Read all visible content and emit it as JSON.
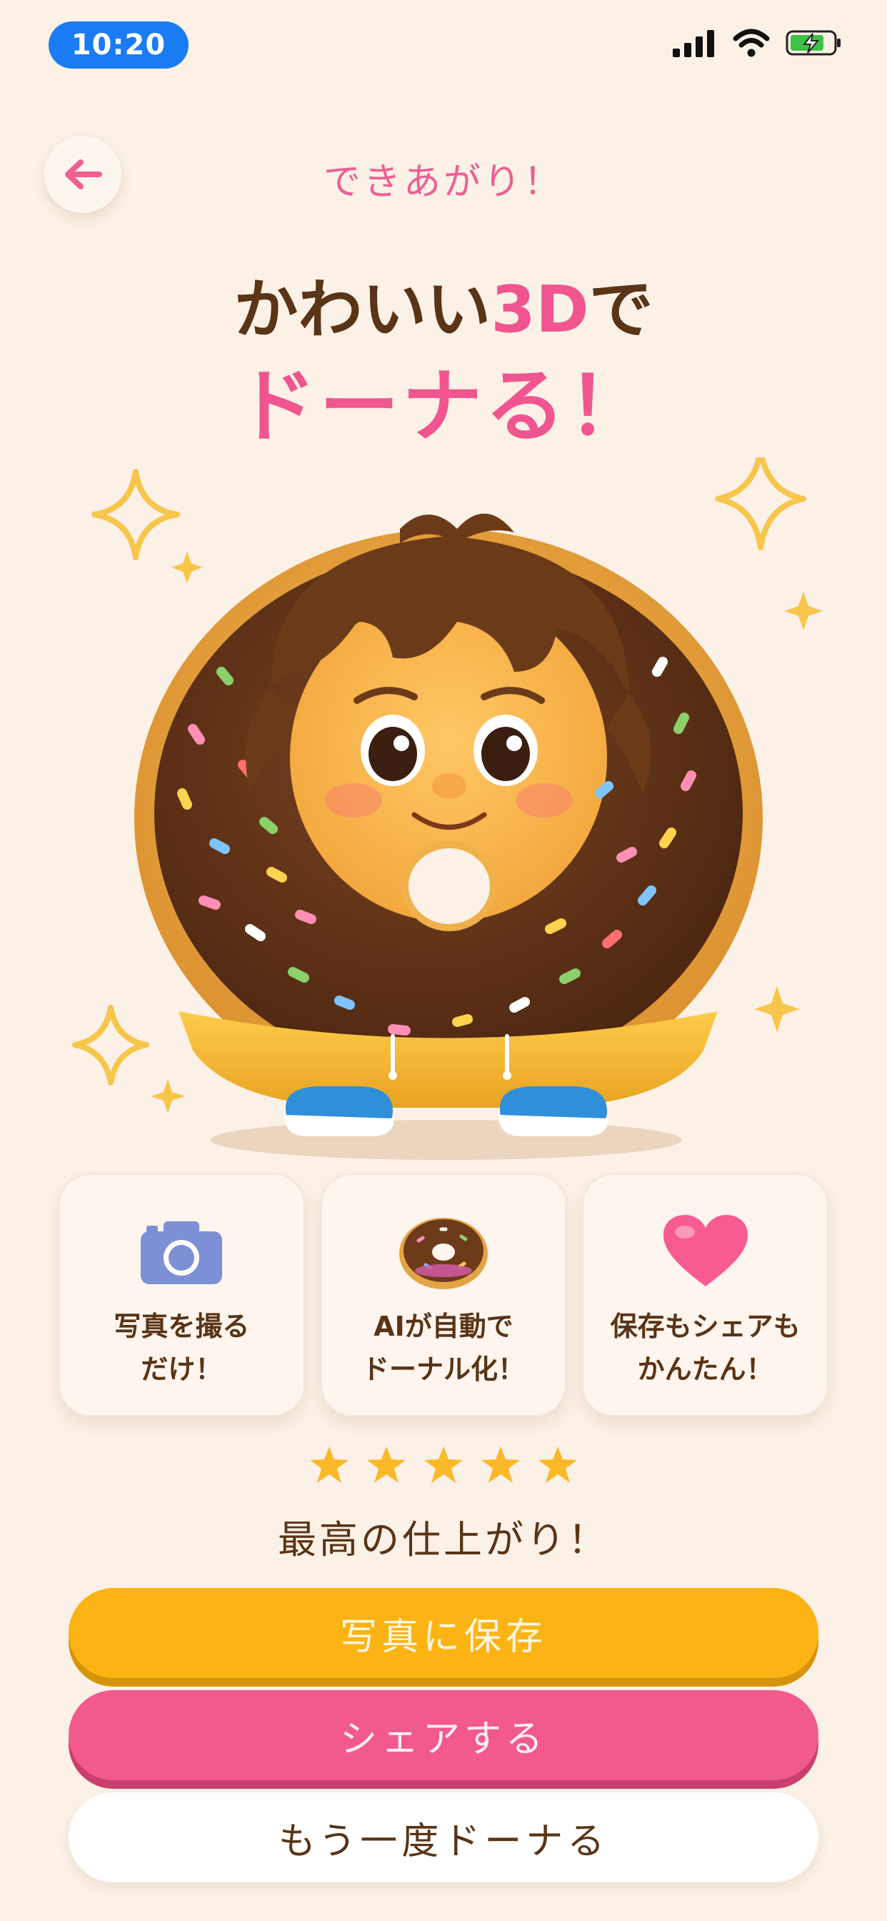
{
  "status_bar": {
    "time": "10:20"
  },
  "header": {
    "title": "できあがり！"
  },
  "headline": {
    "line1_prefix": "かわいい",
    "line1_highlight": "3D",
    "line1_suffix": "で",
    "line2": "ドーナる！"
  },
  "features": [
    {
      "icon": "camera-icon",
      "line1": "写真を撮る",
      "line2": "だけ！"
    },
    {
      "icon": "donut-icon",
      "line1": "AIが自動で",
      "line2": "ドーナル化！"
    },
    {
      "icon": "heart-icon",
      "line1": "保存もシェアも",
      "line2": "かんたん！"
    }
  ],
  "rating": {
    "stars": 5,
    "text": "最高の仕上がり！"
  },
  "buttons": {
    "save": "写真に保存",
    "share": "シェアする",
    "again": "もう一度ドーナる"
  },
  "colors": {
    "background": "#fbf1e7",
    "pink": "#f0558f",
    "yellow": "#fbb414",
    "brown": "#5a3416",
    "blue": "#1a7cf2"
  }
}
